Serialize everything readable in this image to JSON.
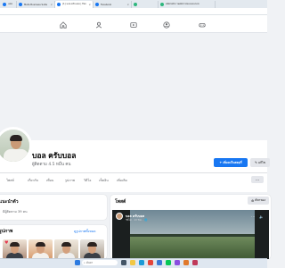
{
  "browser": {
    "tabs": [
      {
        "label": "แชท",
        "active": false
      },
      {
        "label": "Meta Business Suite",
        "active": false
      },
      {
        "label": "(1) บอล ครับบอล | Facebook",
        "active": true
      },
      {
        "label": "Facebook",
        "active": false
      },
      {
        "label": "",
        "active": false
      },
      {
        "label": "สมัครคลิป โพสต์ขายของออนไลน์",
        "active": false
      }
    ]
  },
  "profile": {
    "name": "บอล ครับบอล",
    "followers": "ผู้ติดตาม 4.5 หมื่น คน",
    "add_story_button": "เพิ่มลงในสตอรี่",
    "edit_button": "แก้ไข",
    "tabs": [
      "โพสต์",
      "เกี่ยวกับ",
      "เพื่อน",
      "รูปภาพ",
      "วิดีโอ",
      "เช็คอิน",
      "เพิ่มเติม"
    ],
    "more_button": "···"
  },
  "intro": {
    "title": "แนะนำตัว",
    "detail": "มีผู้ติดตาม 39 คน"
  },
  "photos": {
    "title": "รูปภาพ",
    "see_all": "ดูรูปภาพทั้งหมด"
  },
  "posts": {
    "title": "โพสต์",
    "filter_button": "ตัวกรอง",
    "video": {
      "author": "บอล ครับบอล",
      "meta": "วิดีโอ · 13 ชม. · 🌐"
    }
  },
  "taskbar": {
    "search_placeholder": "ค้นหา"
  },
  "colors": {
    "accent": "#1877f2",
    "background": "#f0f2f5"
  }
}
